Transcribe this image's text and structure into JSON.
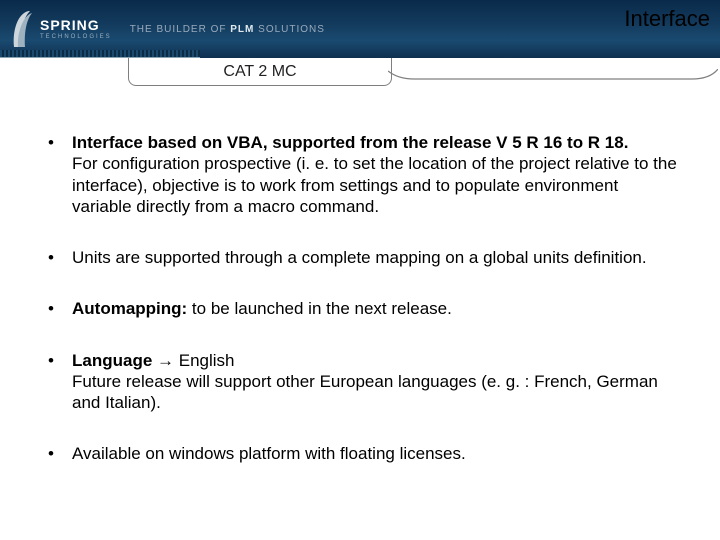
{
  "header": {
    "logo_text": "SPRING",
    "logo_sub": "TECHNOLOGIES",
    "tagline_prefix": "THE BUILDER OF ",
    "tagline_plm": "PLM",
    "tagline_suffix": " SOLUTIONS",
    "title": "Interface"
  },
  "tab": {
    "label": "CAT 2 MC"
  },
  "bullets": {
    "b1_strong": "Interface based on VBA, supported from the release V 5 R 16 to R 18.",
    "b1_rest": "For configuration prospective (i. e. to set the location of the project relative to the interface), objective is to work from settings and to populate environment variable directly from a macro command.",
    "b2": "Units are supported through a complete mapping on a global units definition.",
    "b3_strong": "Automapping:",
    "b3_rest": " to be launched in the next release.",
    "b4_strong": "Language",
    "b4_arrow": " → ",
    "b4_lang": "English",
    "b4_rest": "Future release will support other European languages (e. g. : French, German and Italian).",
    "b5": "Available on windows platform with floating licenses."
  }
}
